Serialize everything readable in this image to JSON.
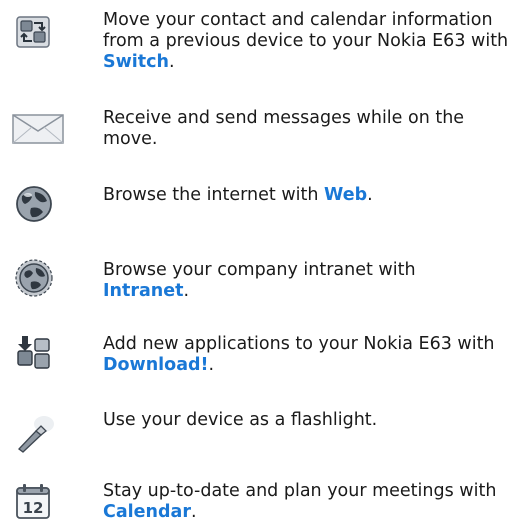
{
  "items": [
    {
      "icon": "switch-icon",
      "text": "Move your contact and calendar information from a previous device to your Nokia E63 with ",
      "link": "Switch",
      "tail": "."
    },
    {
      "icon": "envelope-icon",
      "text": "Receive and send messages while on the move.",
      "link": "",
      "tail": ""
    },
    {
      "icon": "globe-icon",
      "text": "Browse the internet with ",
      "link": "Web",
      "tail": "."
    },
    {
      "icon": "intranet-globe-icon",
      "text": "Browse your company intranet with ",
      "link": "Intranet",
      "tail": "."
    },
    {
      "icon": "download-icon",
      "text": "Add new applications to your Nokia E63 with ",
      "link": "Download!",
      "tail": "."
    },
    {
      "icon": "flashlight-icon",
      "text": "Use your device as a flashlight.",
      "link": "",
      "tail": ""
    },
    {
      "icon": "calendar-icon",
      "text": "Stay up-to-date and plan your meetings with ",
      "link": "Calendar",
      "tail": ".",
      "icon_label": "12"
    }
  ]
}
